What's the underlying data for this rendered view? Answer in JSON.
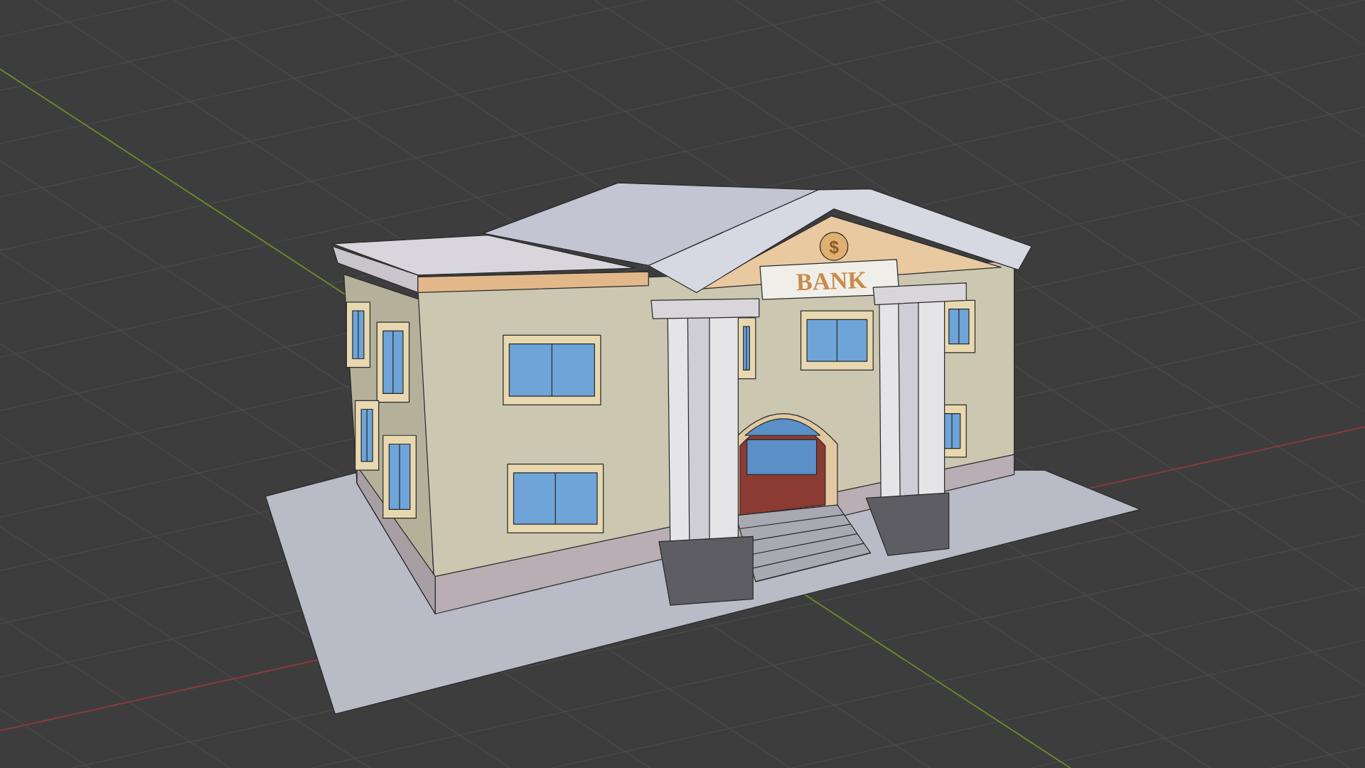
{
  "viewport": {
    "sign_text": "BANK",
    "coin_symbol": "$"
  }
}
